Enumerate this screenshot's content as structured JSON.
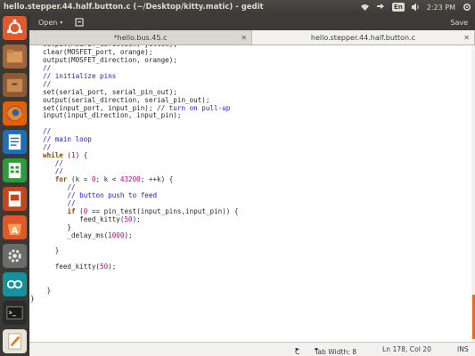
{
  "top_panel": {
    "title": "hello.stepper.44.half.button.c (~/Desktop/kitty.matic) - gedit",
    "keyboard_layout": "En",
    "time": "2:23 PM",
    "icons": [
      "wifi-icon",
      "network-icon",
      "keyboard-icon",
      "volume-icon",
      "settings-gear-icon"
    ]
  },
  "launcher": {
    "items": [
      {
        "name": "dash-home-icon",
        "color": "#e05a2b"
      },
      {
        "name": "files-icon",
        "color": "#a0663b"
      },
      {
        "name": "files-drawer-icon",
        "color": "#8b5a36"
      },
      {
        "name": "firefox-icon",
        "color": "#e66000"
      },
      {
        "name": "writer-icon",
        "color": "#1e6fb8"
      },
      {
        "name": "calc-icon",
        "color": "#2f9a3a"
      },
      {
        "name": "impress-icon",
        "color": "#c2471f"
      },
      {
        "name": "software-center-icon",
        "color": "#e0572b"
      },
      {
        "name": "system-settings-icon",
        "color": "#6b6b6b"
      },
      {
        "name": "arduino-icon",
        "color": "#15909c"
      },
      {
        "name": "terminal-icon",
        "color": "#2c2c2c"
      },
      {
        "name": "text-editor-icon",
        "color": "#e8e4d8"
      }
    ]
  },
  "header": {
    "open_label": "Open",
    "save_label": "Save"
  },
  "tabs": [
    {
      "label": "*hello.bus.45.c",
      "active": false
    },
    {
      "label": "hello.stepper.44.half.button.c",
      "active": true
    }
  ],
  "code_lines": [
    [
      {
        "t": "output(MOSFET_direction, yellow);"
      }
    ],
    [
      {
        "t": "clear(MOSFET_port, orange);"
      }
    ],
    [
      {
        "t": "output(MOSFET_direction, orange);"
      }
    ],
    [
      {
        "t": "//",
        "c": "c"
      }
    ],
    [
      {
        "t": "// initialize pins",
        "c": "c"
      }
    ],
    [
      {
        "t": "//",
        "c": "c"
      }
    ],
    [
      {
        "t": "set(serial_port, serial_pin_out);"
      }
    ],
    [
      {
        "t": "output(serial_direction, serial_pin_out);"
      }
    ],
    [
      {
        "t": "set(input_port, input_pin); "
      },
      {
        "t": "// turn on pull-up",
        "c": "c"
      }
    ],
    [
      {
        "t": "input(input_direction, input_pin);"
      }
    ],
    [
      {
        "t": ""
      }
    ],
    [
      {
        "t": "//",
        "c": "c"
      }
    ],
    [
      {
        "t": "// main loop",
        "c": "c"
      }
    ],
    [
      {
        "t": "//",
        "c": "c"
      }
    ],
    [
      {
        "t": "while",
        "c": "k"
      },
      {
        "t": " ("
      },
      {
        "t": "1",
        "c": "n"
      },
      {
        "t": ") {"
      }
    ],
    [
      {
        "t": "   "
      },
      {
        "t": "//",
        "c": "c"
      }
    ],
    [
      {
        "t": "   "
      },
      {
        "t": "//",
        "c": "c"
      }
    ],
    [
      {
        "t": "   "
      },
      {
        "t": "for",
        "c": "k"
      },
      {
        "t": " (k = "
      },
      {
        "t": "0",
        "c": "n"
      },
      {
        "t": "; k < "
      },
      {
        "t": "43200",
        "c": "n"
      },
      {
        "t": "; ++k) {"
      }
    ],
    [
      {
        "t": "      "
      },
      {
        "t": "//",
        "c": "c"
      }
    ],
    [
      {
        "t": "      "
      },
      {
        "t": "// button push to feed",
        "c": "c"
      }
    ],
    [
      {
        "t": "      "
      },
      {
        "t": "//",
        "c": "c"
      }
    ],
    [
      {
        "t": "      "
      },
      {
        "t": "if",
        "c": "k"
      },
      {
        "t": " ("
      },
      {
        "t": "0",
        "c": "n"
      },
      {
        "t": " == pin_test(input_pins,input_pin)) {"
      }
    ],
    [
      {
        "t": "         feed_kitty("
      },
      {
        "t": "50",
        "c": "n"
      },
      {
        "t": ");"
      }
    ],
    [
      {
        "t": "      }"
      }
    ],
    [
      {
        "t": "      _delay_ms("
      },
      {
        "t": "1000",
        "c": "n"
      },
      {
        "t": ");"
      }
    ],
    [
      {
        "t": ""
      }
    ],
    [
      {
        "t": "   }"
      }
    ],
    [
      {
        "t": ""
      }
    ],
    [
      {
        "t": "   feed_kitty("
      },
      {
        "t": "50",
        "c": "n"
      },
      {
        "t": ");"
      }
    ],
    [
      {
        "t": ""
      }
    ],
    [
      {
        "t": ""
      }
    ],
    [
      {
        "t": " }"
      }
    ],
    [
      {
        "t": "}",
        "indent": -2
      }
    ]
  ],
  "status": {
    "language": "C",
    "tab_width": "Tab Width: 8",
    "position": "Ln 178, Col 20",
    "mode": "INS"
  },
  "colors": {
    "accent": "#e06d2a",
    "comment": "#1a1ad6",
    "keyword": "#8a4a00",
    "number": "#d10080"
  }
}
